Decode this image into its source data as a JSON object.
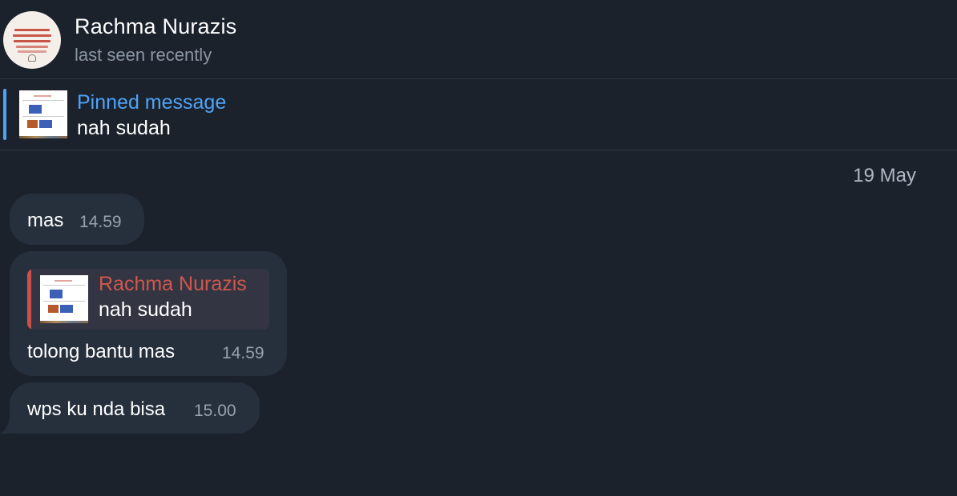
{
  "header": {
    "contact_name": "Rachma Nurazis",
    "status": "last seen recently"
  },
  "pinned": {
    "title": "Pinned message",
    "text": "nah sudah"
  },
  "date_separator": "19 May",
  "messages": [
    {
      "text": "mas",
      "time": "14.59"
    },
    {
      "reply": {
        "author": "Rachma Nurazis",
        "text": "nah sudah"
      },
      "text": "tolong bantu mas",
      "time": "14.59"
    },
    {
      "text": "wps ku nda bisa",
      "time": "15.00"
    }
  ],
  "colors": {
    "background": "#1b222c",
    "bubble": "#262f3c",
    "accent_blue": "#4fa3f7",
    "reply_red": "#d1574d"
  }
}
